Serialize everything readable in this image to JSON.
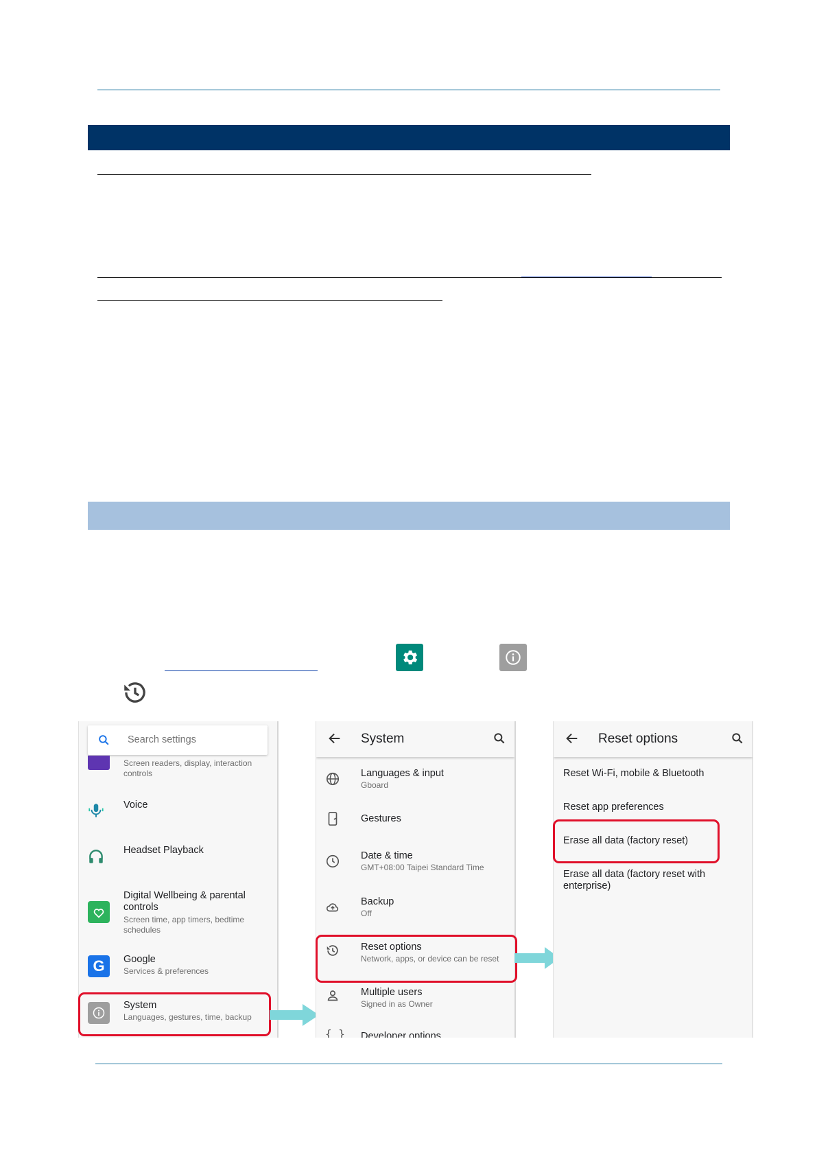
{
  "colors": {
    "dark_band": "#003366",
    "light_band": "#a6c1de",
    "highlight": "#e0102a",
    "arrow": "#7fd6da",
    "settings_icon_bg": "#00897b",
    "about_icon_bg": "#9e9e9e"
  },
  "icons": [
    "gear-icon",
    "info-icon",
    "history-icon",
    "search-icon",
    "back-arrow-icon"
  ],
  "settings_panel": {
    "search_placeholder": "Search settings",
    "items": [
      {
        "title": "",
        "subtitle": "Screen readers, display, interaction controls",
        "icon": "accessibility-icon"
      },
      {
        "title": "Voice",
        "subtitle": "",
        "icon": "mic-icon"
      },
      {
        "title": "Headset Playback",
        "subtitle": "",
        "icon": "headset-icon"
      },
      {
        "title": "Digital Wellbeing & parental controls",
        "subtitle": "Screen time, app timers, bedtime schedules",
        "icon": "wellbeing-icon"
      },
      {
        "title": "Google",
        "subtitle": "Services & preferences",
        "icon": "google-icon"
      },
      {
        "title": "System",
        "subtitle": "Languages, gestures, time, backup",
        "icon": "info-icon"
      }
    ]
  },
  "system_panel": {
    "title": "System",
    "items": [
      {
        "title": "Languages & input",
        "subtitle": "Gboard",
        "icon": "globe-icon"
      },
      {
        "title": "Gestures",
        "subtitle": "",
        "icon": "phone-gesture-icon"
      },
      {
        "title": "Date & time",
        "subtitle": "GMT+08:00 Taipei Standard Time",
        "icon": "clock-icon"
      },
      {
        "title": "Backup",
        "subtitle": "Off",
        "icon": "cloud-upload-icon"
      },
      {
        "title": "Reset options",
        "subtitle": "Network, apps, or device can be reset",
        "icon": "history-icon"
      },
      {
        "title": "Multiple users",
        "subtitle": "Signed in as Owner",
        "icon": "person-icon"
      },
      {
        "title": "Developer options",
        "subtitle": "",
        "icon": "braces-icon"
      }
    ]
  },
  "reset_panel": {
    "title": "Reset options",
    "items": [
      {
        "title": "Reset Wi-Fi, mobile & Bluetooth"
      },
      {
        "title": "Reset app preferences"
      },
      {
        "title": "Erase all data (factory reset)"
      },
      {
        "title": "Erase all data (factory reset with enterprise)"
      }
    ]
  }
}
